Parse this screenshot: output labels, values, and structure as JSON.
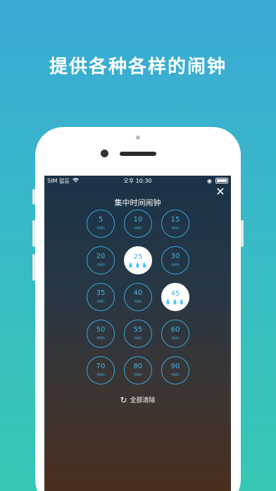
{
  "headline": "提供各种各样的闹钟",
  "status_bar": {
    "carrier": "SIM 없음",
    "wifi_icon": "wifi-icon",
    "time": "오후 10:30",
    "battery_icon": "battery-icon"
  },
  "modal": {
    "title": "集中时间闹钟",
    "close_icon": "close-icon",
    "unit_label": "min",
    "cells": [
      {
        "value": "5"
      },
      {
        "value": "10"
      },
      {
        "value": "15"
      },
      {
        "value": "20"
      },
      {
        "value": "25",
        "selected": true,
        "drops": "💧💧💧"
      },
      {
        "value": "30"
      },
      {
        "value": "35"
      },
      {
        "value": "40"
      },
      {
        "value": "45",
        "selected": true,
        "drops": "💧💧💧"
      },
      {
        "value": "50"
      },
      {
        "value": "55"
      },
      {
        "value": "60"
      },
      {
        "value": "70"
      },
      {
        "value": "80"
      },
      {
        "value": "90"
      }
    ],
    "clear_all": "全部清除",
    "clear_icon": "refresh-icon"
  },
  "colors": {
    "accent": "#3aa8d8",
    "background_top": "#3aa9d6",
    "background_bottom": "#36c8b4"
  }
}
